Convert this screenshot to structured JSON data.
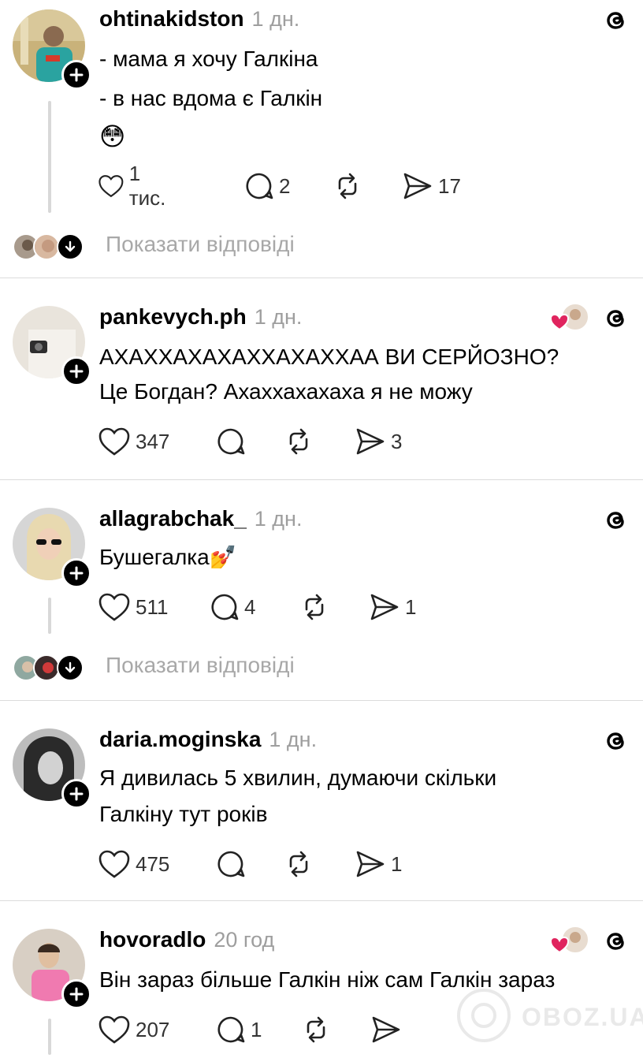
{
  "colors": {
    "like_heart": "#e0245e",
    "muted": "#9e9e9e",
    "divider": "#dcdcdc"
  },
  "posts": [
    {
      "username": "ohtinakidston",
      "time": "1 дн.",
      "lines": [
        "- мама я хочу Галкіна",
        "- в нас вдома є Галкін",
        "😳"
      ],
      "likes": "1 тис.",
      "replies": "2",
      "shares": "17",
      "show_replies": "Показати відповіді"
    },
    {
      "username": "pankevych.ph",
      "time": "1 дн.",
      "lines": [
        "АХАХХАХАХАХХАХАХХАА ВИ СЕРЙОЗНО?",
        "Це Богдан? Ахаххахахаха я не можу"
      ],
      "likes": "347",
      "replies": "",
      "shares": "3"
    },
    {
      "username": "allagrabchak_",
      "time": "1 дн.",
      "lines": [
        "Бушегалка💅"
      ],
      "likes": "511",
      "replies": "4",
      "shares": "1",
      "show_replies": "Показати відповіді"
    },
    {
      "username": "daria.moginska",
      "time": "1 дн.",
      "lines": [
        "Я дивилась 5 хвилин, думаючи скільки",
        "Галкіну тут років"
      ],
      "likes": "475",
      "replies": "",
      "shares": "1"
    },
    {
      "username": "hovoradlo",
      "time": "20 год",
      "lines": [
        "Він зараз більше Галкін ніж сам Галкін зараз"
      ],
      "likes": "207",
      "replies": "1",
      "shares": ""
    }
  ],
  "watermark": "OBOZ.UA",
  "icons": [
    "threads-icon",
    "heart-icon",
    "comment-icon",
    "repost-icon",
    "share-icon",
    "plus-icon",
    "arrow-down-icon"
  ]
}
